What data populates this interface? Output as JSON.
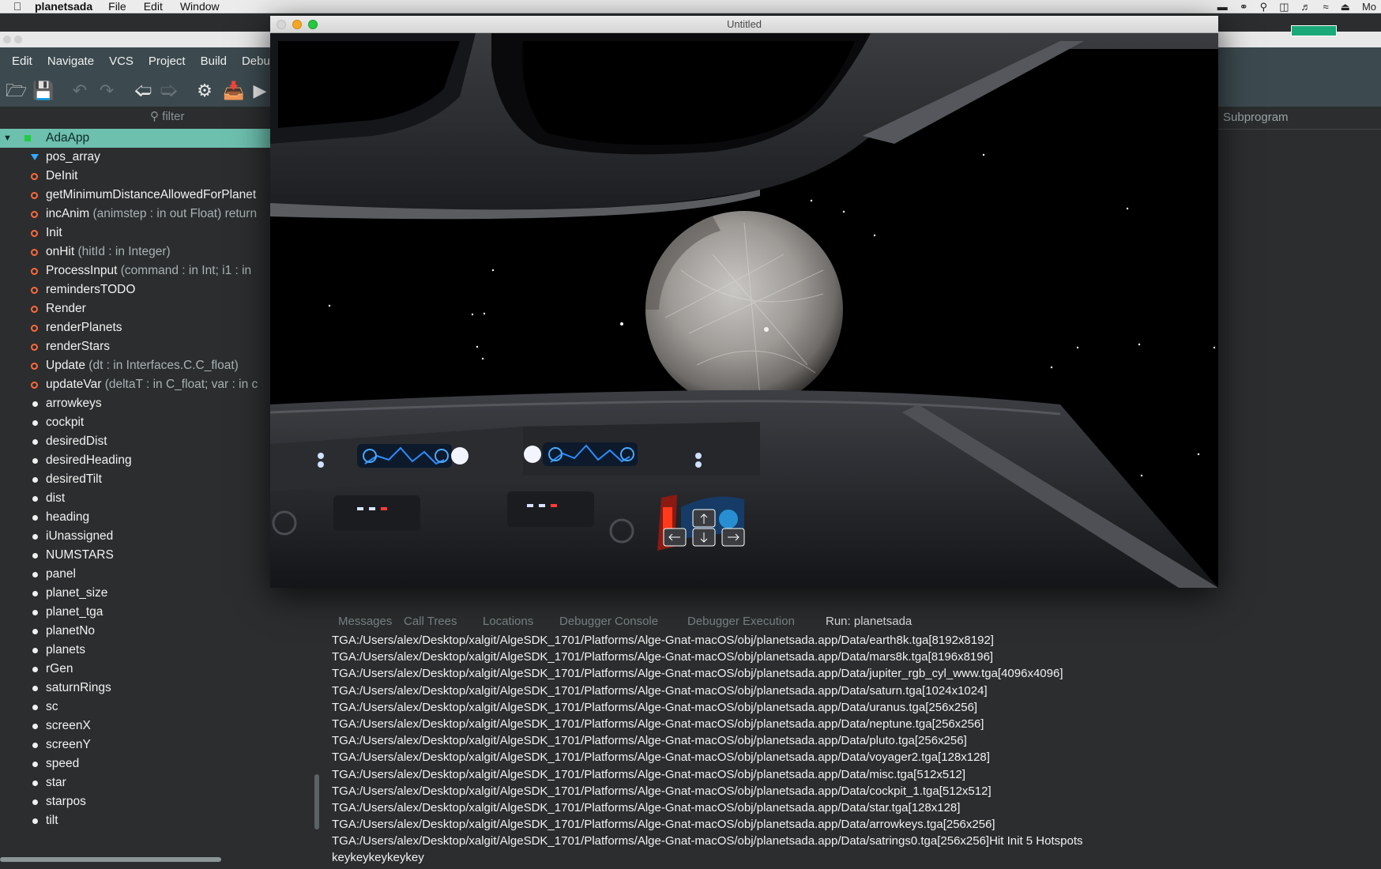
{
  "mac_menubar": {
    "app_name": "planetsada",
    "items": [
      "File",
      "Edit",
      "Window"
    ],
    "clock_partial": "Mo"
  },
  "ide": {
    "menu": [
      "Edit",
      "Navigate",
      "VCS",
      "Project",
      "Build",
      "Debu"
    ],
    "filter_placeholder": "filter",
    "right_header": "Subprogram",
    "outline": {
      "root": "AdaApp",
      "items": [
        {
          "name": "pos_array",
          "sig": "",
          "kind": "type"
        },
        {
          "name": "DeInit",
          "sig": "",
          "kind": "sub"
        },
        {
          "name": "getMinimumDistanceAllowedForPlanet",
          "sig": "",
          "kind": "sub"
        },
        {
          "name": "incAnim",
          "sig": " (animstep : in out Float) return",
          "kind": "sub"
        },
        {
          "name": "Init",
          "sig": "",
          "kind": "sub"
        },
        {
          "name": "onHit",
          "sig": " (hitId : in Integer)",
          "kind": "sub"
        },
        {
          "name": "ProcessInput",
          "sig": " (command : in Int; i1 : in",
          "kind": "sub"
        },
        {
          "name": "remindersTODO",
          "sig": "",
          "kind": "sub"
        },
        {
          "name": "Render",
          "sig": "",
          "kind": "sub"
        },
        {
          "name": "renderPlanets",
          "sig": "",
          "kind": "sub"
        },
        {
          "name": "renderStars",
          "sig": "",
          "kind": "sub"
        },
        {
          "name": "Update",
          "sig": " (dt : in Interfaces.C.C_float)",
          "kind": "sub"
        },
        {
          "name": "updateVar",
          "sig": " (deltaT : in C_float; var : in c",
          "kind": "sub"
        },
        {
          "name": "arrowkeys",
          "sig": "",
          "kind": "var"
        },
        {
          "name": "cockpit",
          "sig": "",
          "kind": "var"
        },
        {
          "name": "desiredDist",
          "sig": "",
          "kind": "var"
        },
        {
          "name": "desiredHeading",
          "sig": "",
          "kind": "var"
        },
        {
          "name": "desiredTilt",
          "sig": "",
          "kind": "var"
        },
        {
          "name": "dist",
          "sig": "",
          "kind": "var"
        },
        {
          "name": "heading",
          "sig": "",
          "kind": "var"
        },
        {
          "name": "iUnassigned",
          "sig": "",
          "kind": "var"
        },
        {
          "name": "NUMSTARS",
          "sig": "",
          "kind": "var"
        },
        {
          "name": "panel",
          "sig": "",
          "kind": "var"
        },
        {
          "name": "planet_size",
          "sig": "",
          "kind": "var"
        },
        {
          "name": "planet_tga",
          "sig": "",
          "kind": "var"
        },
        {
          "name": "planetNo",
          "sig": "",
          "kind": "var"
        },
        {
          "name": "planets",
          "sig": "",
          "kind": "var"
        },
        {
          "name": "rGen",
          "sig": "",
          "kind": "var"
        },
        {
          "name": "saturnRings",
          "sig": "",
          "kind": "var"
        },
        {
          "name": "sc",
          "sig": "",
          "kind": "var"
        },
        {
          "name": "screenX",
          "sig": "",
          "kind": "var"
        },
        {
          "name": "screenY",
          "sig": "",
          "kind": "var"
        },
        {
          "name": "speed",
          "sig": "",
          "kind": "var"
        },
        {
          "name": "star",
          "sig": "",
          "kind": "var"
        },
        {
          "name": "starpos",
          "sig": "",
          "kind": "var"
        },
        {
          "name": "tilt",
          "sig": "",
          "kind": "var"
        }
      ]
    },
    "bottom_tabs": [
      "Messages",
      "Call Trees",
      "Locations",
      "Debugger Console",
      "Debugger Execution",
      "Run: planetsada"
    ],
    "console_lines": [
      "TGA:/Users/alex/Desktop/xalgit/AlgeSDK_1701/Platforms/Alge-Gnat-macOS/obj/planetsada.app/Data/earth8k.tga[8192x8192]",
      "TGA:/Users/alex/Desktop/xalgit/AlgeSDK_1701/Platforms/Alge-Gnat-macOS/obj/planetsada.app/Data/mars8k.tga[8196x8196]",
      "TGA:/Users/alex/Desktop/xalgit/AlgeSDK_1701/Platforms/Alge-Gnat-macOS/obj/planetsada.app/Data/jupiter_rgb_cyl_www.tga[4096x4096]",
      "TGA:/Users/alex/Desktop/xalgit/AlgeSDK_1701/Platforms/Alge-Gnat-macOS/obj/planetsada.app/Data/saturn.tga[1024x1024]",
      "TGA:/Users/alex/Desktop/xalgit/AlgeSDK_1701/Platforms/Alge-Gnat-macOS/obj/planetsada.app/Data/uranus.tga[256x256]",
      "TGA:/Users/alex/Desktop/xalgit/AlgeSDK_1701/Platforms/Alge-Gnat-macOS/obj/planetsada.app/Data/neptune.tga[256x256]",
      "TGA:/Users/alex/Desktop/xalgit/AlgeSDK_1701/Platforms/Alge-Gnat-macOS/obj/planetsada.app/Data/pluto.tga[256x256]",
      "TGA:/Users/alex/Desktop/xalgit/AlgeSDK_1701/Platforms/Alge-Gnat-macOS/obj/planetsada.app/Data/voyager2.tga[128x128]",
      "TGA:/Users/alex/Desktop/xalgit/AlgeSDK_1701/Platforms/Alge-Gnat-macOS/obj/planetsada.app/Data/misc.tga[512x512]",
      "TGA:/Users/alex/Desktop/xalgit/AlgeSDK_1701/Platforms/Alge-Gnat-macOS/obj/planetsada.app/Data/cockpit_1.tga[512x512]",
      "TGA:/Users/alex/Desktop/xalgit/AlgeSDK_1701/Platforms/Alge-Gnat-macOS/obj/planetsada.app/Data/star.tga[128x128]",
      "TGA:/Users/alex/Desktop/xalgit/AlgeSDK_1701/Platforms/Alge-Gnat-macOS/obj/planetsada.app/Data/arrowkeys.tga[256x256]",
      "TGA:/Users/alex/Desktop/xalgit/AlgeSDK_1701/Platforms/Alge-Gnat-macOS/obj/planetsada.app/Data/satrings0.tga[256x256]Hit Init 5 Hotspots",
      "keykeykeykeykey"
    ]
  },
  "game_window": {
    "title": "Untitled"
  },
  "colors": {
    "ide_bg": "#2b2d2e",
    "ide_bar": "#3c4a4f",
    "selection": "#6dbfae",
    "subprogram_icon": "#ff6a3c",
    "traffic_red": "#d6d6d6",
    "traffic_yellow": "#f5a623",
    "traffic_green": "#27c93f"
  }
}
